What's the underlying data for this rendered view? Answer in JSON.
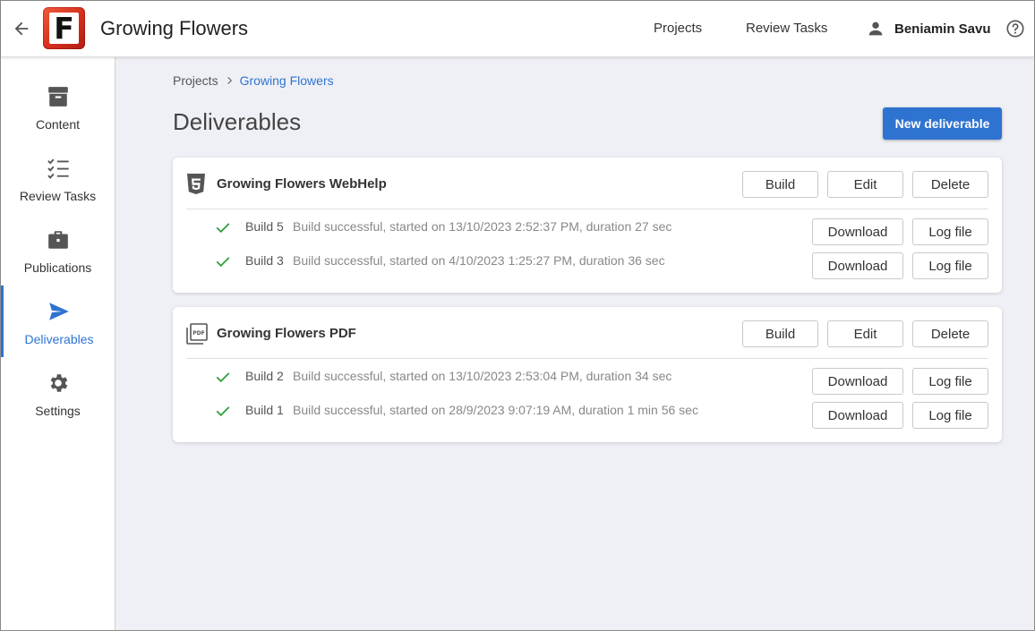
{
  "header": {
    "app_title": "Growing Flowers",
    "logo_letter": "F",
    "nav": [
      "Projects",
      "Review Tasks"
    ],
    "user_name": "Beniamin Savu"
  },
  "sidebar": {
    "items": [
      {
        "label": "Content",
        "icon": "archive-box-icon"
      },
      {
        "label": "Review Tasks",
        "icon": "checklist-icon"
      },
      {
        "label": "Publications",
        "icon": "briefcase-icon"
      },
      {
        "label": "Deliverables",
        "icon": "send-icon",
        "active": true
      },
      {
        "label": "Settings",
        "icon": "gear-icon"
      }
    ]
  },
  "breadcrumb": {
    "root": "Projects",
    "current": "Growing Flowers"
  },
  "page_title": "Deliverables",
  "new_button": "New deliverable",
  "actions": {
    "build": "Build",
    "edit": "Edit",
    "delete": "Delete",
    "download": "Download",
    "log": "Log file"
  },
  "deliverables": [
    {
      "title": "Growing Flowers WebHelp",
      "icon": "html5-icon",
      "builds": [
        {
          "name": "Build 5",
          "desc": "Build successful, started on 13/10/2023 2:52:37 PM, duration 27 sec"
        },
        {
          "name": "Build 3",
          "desc": "Build successful, started on 4/10/2023 1:25:27 PM, duration 36 sec"
        }
      ]
    },
    {
      "title": "Growing Flowers PDF",
      "icon": "pdf-icon",
      "builds": [
        {
          "name": "Build 2",
          "desc": "Build successful, started on 13/10/2023 2:53:04 PM, duration 34 sec"
        },
        {
          "name": "Build 1",
          "desc": "Build successful, started on 28/9/2023 9:07:19 AM, duration 1 min 56 sec"
        }
      ]
    }
  ],
  "colors": {
    "accent": "#2f73d1",
    "success": "#2e9e3a",
    "logo": "#d42e1c"
  }
}
